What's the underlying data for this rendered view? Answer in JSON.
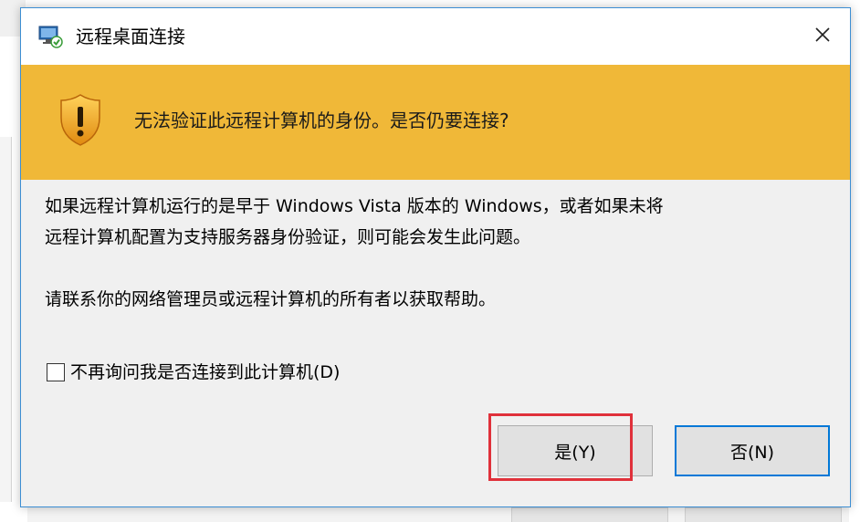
{
  "window": {
    "title": "远程桌面连接",
    "close_glyph": "✕"
  },
  "banner": {
    "message": "无法验证此远程计算机的身份。是否仍要连接?",
    "color": "#f0b838"
  },
  "body": {
    "line1": "如果远程计算机运行的是早于 Windows Vista 版本的 Windows，或者如果未将",
    "line2": "远程计算机配置为支持服务器身份验证，则可能会发生此问题。",
    "line3": "请联系你的网络管理员或远程计算机的所有者以获取帮助。"
  },
  "checkbox": {
    "label": "不再询问我是否连接到此计算机(D)",
    "checked": false
  },
  "buttons": {
    "yes_label": "是(Y)",
    "no_label": "否(N)"
  },
  "colors": {
    "accent": "#0078d7",
    "highlight": "#e0313b"
  },
  "icons": {
    "title": "remote-desktop-icon",
    "banner": "warning-shield-icon",
    "close": "close-icon"
  }
}
